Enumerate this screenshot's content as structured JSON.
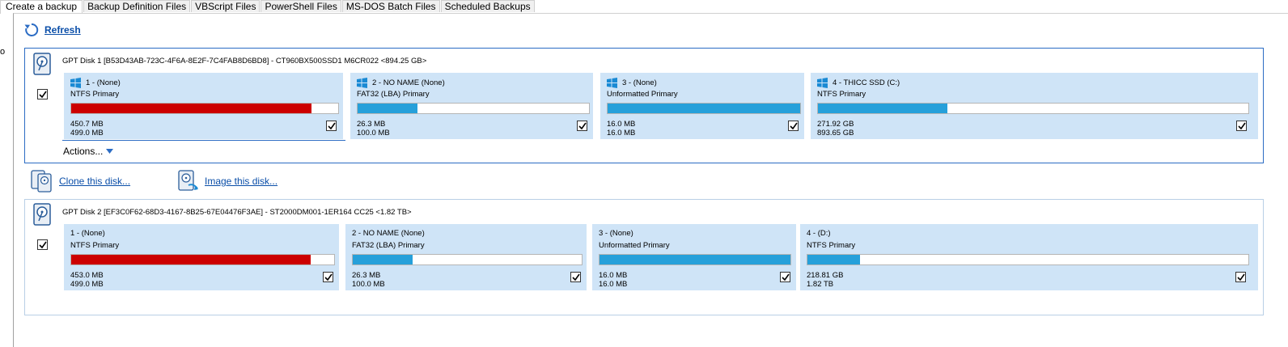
{
  "tabs": [
    {
      "label": "Create a backup",
      "active": true
    },
    {
      "label": "Backup Definition Files",
      "active": false
    },
    {
      "label": "VBScript Files",
      "active": false
    },
    {
      "label": "PowerShell Files",
      "active": false
    },
    {
      "label": "MS-DOS Batch Files",
      "active": false
    },
    {
      "label": "Scheduled Backups",
      "active": false
    }
  ],
  "gutter_text": "o",
  "refresh_label": "Refresh",
  "colors": {
    "accent": "#2b6cc4",
    "used_red": "#cc0000",
    "used_blue": "#26a0da",
    "partition_bg": "#cfe4f7"
  },
  "disk1": {
    "title": "GPT Disk 1 [B53D43AB-723C-4F6A-8E2F-7C4FAB8D6BD8] - CT960BX500SSD1  M6CR022  <894.25 GB>",
    "checked": true,
    "actions_label": "Actions...",
    "partitions": [
      {
        "title": "1 -  (None)",
        "fs": "NTFS Primary",
        "used": "450.7 MB",
        "total": "499.0 MB",
        "fill": 0.9,
        "color": "#cc0000",
        "checked": true,
        "win_icon": true
      },
      {
        "title": "2 - NO NAME (None)",
        "fs": "FAT32 (LBA) Primary",
        "used": "26.3 MB",
        "total": "100.0 MB",
        "fill": 0.26,
        "color": "#26a0da",
        "checked": true,
        "win_icon": true
      },
      {
        "title": "3 -  (None)",
        "fs": "Unformatted Primary",
        "used": "16.0 MB",
        "total": "16.0 MB",
        "fill": 1.0,
        "color": "#26a0da",
        "checked": true,
        "win_icon": true
      },
      {
        "title": "4 - THICC SSD (C:)",
        "fs": "NTFS Primary",
        "used": "271.92 GB",
        "total": "893.65 GB",
        "fill": 0.3,
        "color": "#26a0da",
        "checked": true,
        "win_icon": true
      }
    ]
  },
  "clone_label": "Clone this disk...",
  "image_label": "Image this disk...",
  "disk2": {
    "title": "GPT Disk 2 [EF3C0F62-68D3-4167-8B25-67E04476F3AE] - ST2000DM001-1ER164 CC25  <1.82 TB>",
    "checked": true,
    "partitions": [
      {
        "title": "1 -  (None)",
        "fs": "NTFS Primary",
        "used": "453.0 MB",
        "total": "499.0 MB",
        "fill": 0.91,
        "color": "#cc0000",
        "checked": true,
        "win_icon": false
      },
      {
        "title": "2 - NO NAME (None)",
        "fs": "FAT32 (LBA) Primary",
        "used": "26.3 MB",
        "total": "100.0 MB",
        "fill": 0.26,
        "color": "#26a0da",
        "checked": true,
        "win_icon": false
      },
      {
        "title": "3 -  (None)",
        "fs": "Unformatted Primary",
        "used": "16.0 MB",
        "total": "16.0 MB",
        "fill": 1.0,
        "color": "#26a0da",
        "checked": true,
        "win_icon": false
      },
      {
        "title": "4 -  (D:)",
        "fs": "NTFS Primary",
        "used": "218.81 GB",
        "total": "1.82 TB",
        "fill": 0.12,
        "color": "#26a0da",
        "checked": true,
        "win_icon": false
      }
    ]
  }
}
